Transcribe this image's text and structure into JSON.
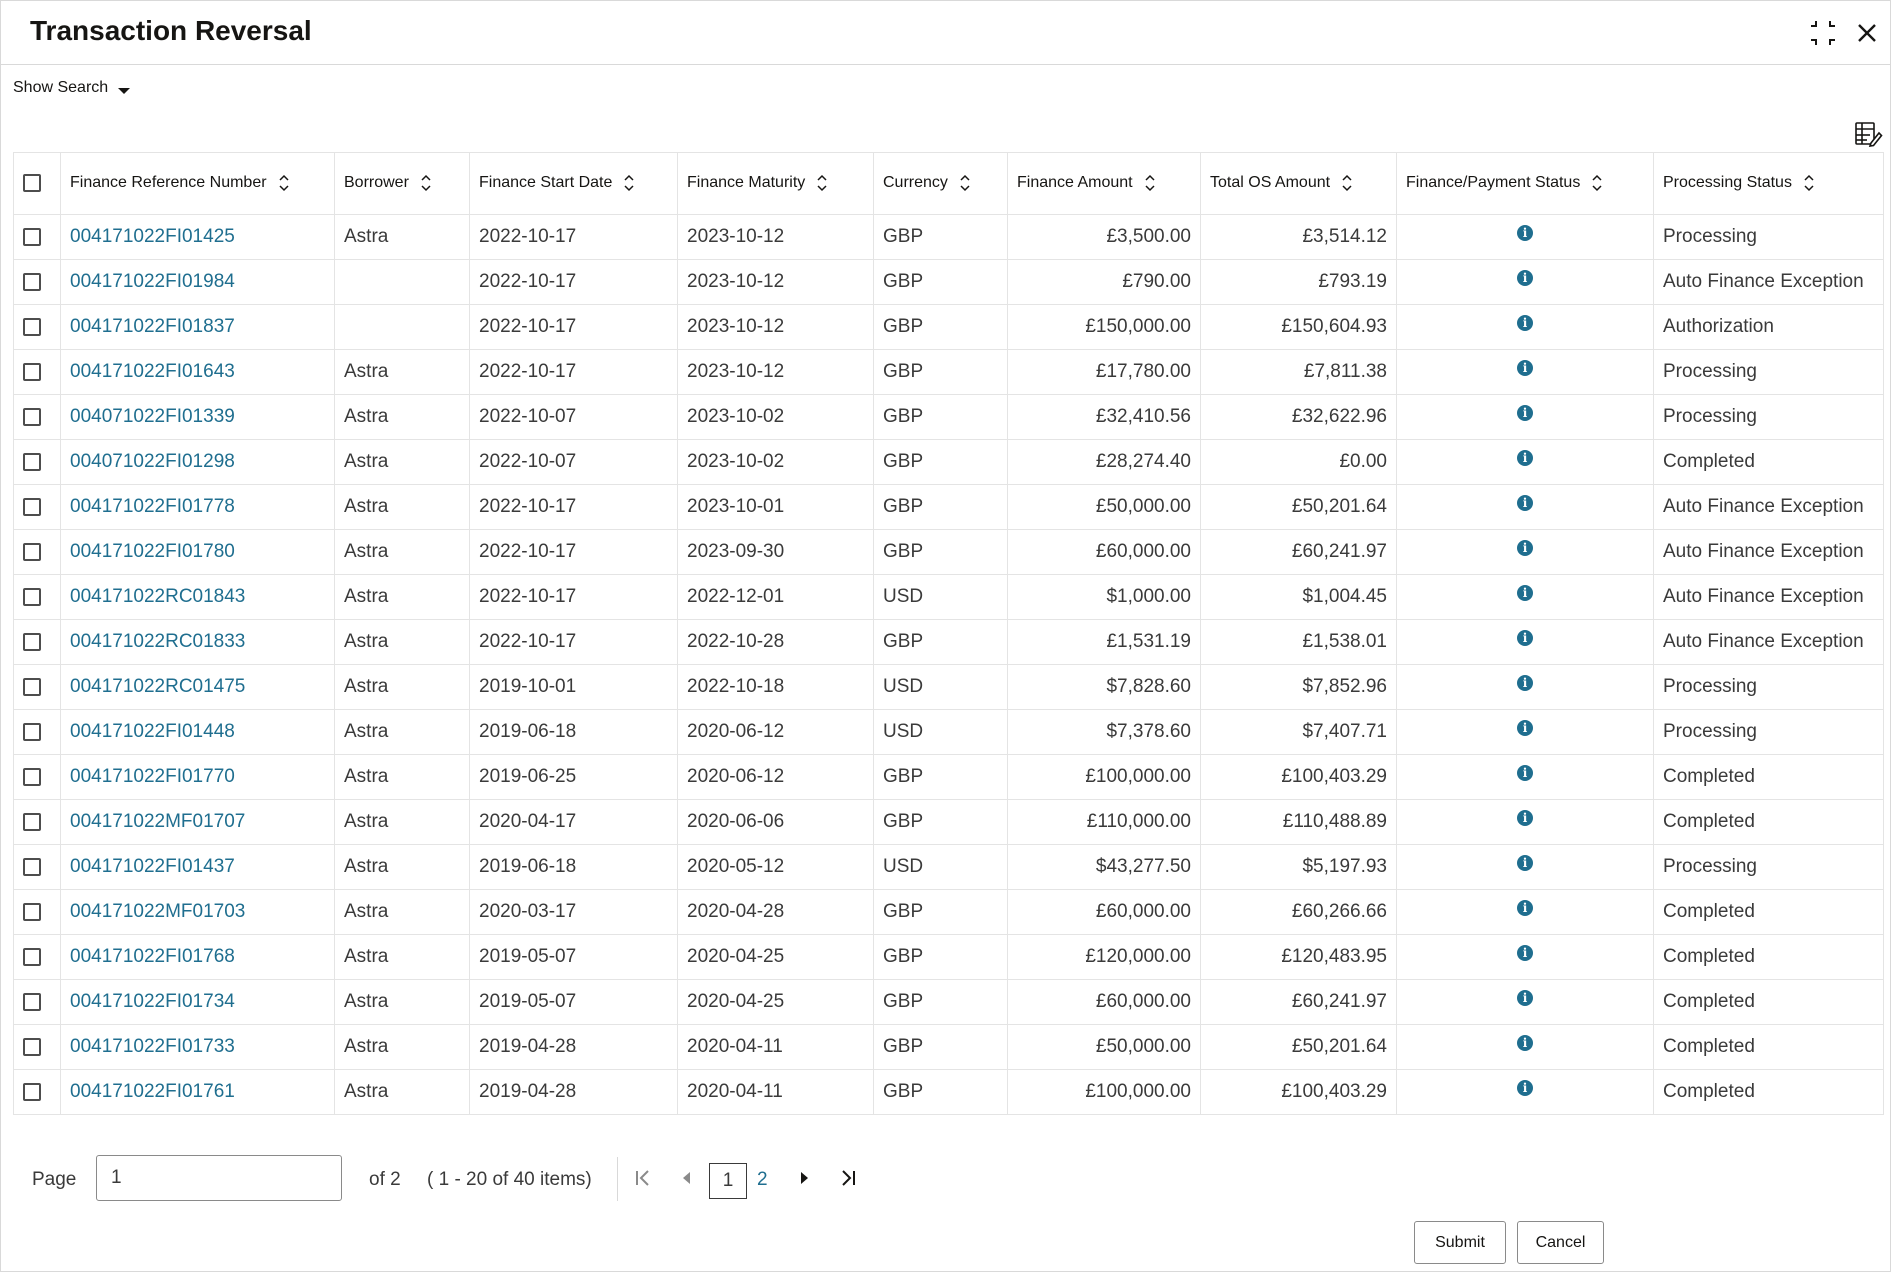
{
  "window": {
    "title": "Transaction Reversal"
  },
  "search_toggle": {
    "label": "Show Search"
  },
  "icons": {
    "minimize": "minimize-icon",
    "close": "close-icon",
    "grid_settings": "grid-settings-icon",
    "info": "info-icon",
    "sort": "sort-icon"
  },
  "colors": {
    "link": "#1f6e8f",
    "info_icon": "#1f6e8f",
    "border": "#e4e4e4"
  },
  "table": {
    "columns": [
      "Finance Reference Number",
      "Borrower",
      "Finance Start Date",
      "Finance Maturity",
      "Currency",
      "Finance Amount",
      "Total OS Amount",
      "Finance/Payment Status",
      "Processing Status"
    ],
    "rows": [
      {
        "ref": "004171022FI01425",
        "borrower": "Astra",
        "start": "2022-10-17",
        "maturity": "2023-10-12",
        "currency": "GBP",
        "amount": "£3,500.00",
        "os_amount": "£3,514.12",
        "status": "Processing"
      },
      {
        "ref": "004171022FI01984",
        "borrower": "",
        "start": "2022-10-17",
        "maturity": "2023-10-12",
        "currency": "GBP",
        "amount": "£790.00",
        "os_amount": "£793.19",
        "status": "Auto Finance Exception"
      },
      {
        "ref": "004171022FI01837",
        "borrower": "",
        "start": "2022-10-17",
        "maturity": "2023-10-12",
        "currency": "GBP",
        "amount": "£150,000.00",
        "os_amount": "£150,604.93",
        "status": "Authorization"
      },
      {
        "ref": "004171022FI01643",
        "borrower": "Astra",
        "start": "2022-10-17",
        "maturity": "2023-10-12",
        "currency": "GBP",
        "amount": "£17,780.00",
        "os_amount": "£7,811.38",
        "status": "Processing"
      },
      {
        "ref": "004071022FI01339",
        "borrower": "Astra",
        "start": "2022-10-07",
        "maturity": "2023-10-02",
        "currency": "GBP",
        "amount": "£32,410.56",
        "os_amount": "£32,622.96",
        "status": "Processing"
      },
      {
        "ref": "004071022FI01298",
        "borrower": "Astra",
        "start": "2022-10-07",
        "maturity": "2023-10-02",
        "currency": "GBP",
        "amount": "£28,274.40",
        "os_amount": "£0.00",
        "status": "Completed"
      },
      {
        "ref": "004171022FI01778",
        "borrower": "Astra",
        "start": "2022-10-17",
        "maturity": "2023-10-01",
        "currency": "GBP",
        "amount": "£50,000.00",
        "os_amount": "£50,201.64",
        "status": "Auto Finance Exception"
      },
      {
        "ref": "004171022FI01780",
        "borrower": "Astra",
        "start": "2022-10-17",
        "maturity": "2023-09-30",
        "currency": "GBP",
        "amount": "£60,000.00",
        "os_amount": "£60,241.97",
        "status": "Auto Finance Exception"
      },
      {
        "ref": "004171022RC01843",
        "borrower": "Astra",
        "start": "2022-10-17",
        "maturity": "2022-12-01",
        "currency": "USD",
        "amount": "$1,000.00",
        "os_amount": "$1,004.45",
        "status": "Auto Finance Exception"
      },
      {
        "ref": "004171022RC01833",
        "borrower": "Astra",
        "start": "2022-10-17",
        "maturity": "2022-10-28",
        "currency": "GBP",
        "amount": "£1,531.19",
        "os_amount": "£1,538.01",
        "status": "Auto Finance Exception"
      },
      {
        "ref": "004171022RC01475",
        "borrower": "Astra",
        "start": "2019-10-01",
        "maturity": "2022-10-18",
        "currency": "USD",
        "amount": "$7,828.60",
        "os_amount": "$7,852.96",
        "status": "Processing"
      },
      {
        "ref": "004171022FI01448",
        "borrower": "Astra",
        "start": "2019-06-18",
        "maturity": "2020-06-12",
        "currency": "USD",
        "amount": "$7,378.60",
        "os_amount": "$7,407.71",
        "status": "Processing"
      },
      {
        "ref": "004171022FI01770",
        "borrower": "Astra",
        "start": "2019-06-25",
        "maturity": "2020-06-12",
        "currency": "GBP",
        "amount": "£100,000.00",
        "os_amount": "£100,403.29",
        "status": "Completed"
      },
      {
        "ref": "004171022MF01707",
        "borrower": "Astra",
        "start": "2020-04-17",
        "maturity": "2020-06-06",
        "currency": "GBP",
        "amount": "£110,000.00",
        "os_amount": "£110,488.89",
        "status": "Completed"
      },
      {
        "ref": "004171022FI01437",
        "borrower": "Astra",
        "start": "2019-06-18",
        "maturity": "2020-05-12",
        "currency": "USD",
        "amount": "$43,277.50",
        "os_amount": "$5,197.93",
        "status": "Processing"
      },
      {
        "ref": "004171022MF01703",
        "borrower": "Astra",
        "start": "2020-03-17",
        "maturity": "2020-04-28",
        "currency": "GBP",
        "amount": "£60,000.00",
        "os_amount": "£60,266.66",
        "status": "Completed"
      },
      {
        "ref": "004171022FI01768",
        "borrower": "Astra",
        "start": "2019-05-07",
        "maturity": "2020-04-25",
        "currency": "GBP",
        "amount": "£120,000.00",
        "os_amount": "£120,483.95",
        "status": "Completed"
      },
      {
        "ref": "004171022FI01734",
        "borrower": "Astra",
        "start": "2019-05-07",
        "maturity": "2020-04-25",
        "currency": "GBP",
        "amount": "£60,000.00",
        "os_amount": "£60,241.97",
        "status": "Completed"
      },
      {
        "ref": "004171022FI01733",
        "borrower": "Astra",
        "start": "2019-04-28",
        "maturity": "2020-04-11",
        "currency": "GBP",
        "amount": "£50,000.00",
        "os_amount": "£50,201.64",
        "status": "Completed"
      },
      {
        "ref": "004171022FI01761",
        "borrower": "Astra",
        "start": "2019-04-28",
        "maturity": "2020-04-11",
        "currency": "GBP",
        "amount": "£100,000.00",
        "os_amount": "£100,403.29",
        "status": "Completed"
      }
    ]
  },
  "pagination": {
    "page_label": "Page",
    "page_value": "1",
    "of_total": "of 2",
    "items_info": "( 1 - 20 of 40 items)",
    "current_page": "1",
    "next_page": "2"
  },
  "actions": {
    "submit": "Submit",
    "cancel": "Cancel"
  }
}
